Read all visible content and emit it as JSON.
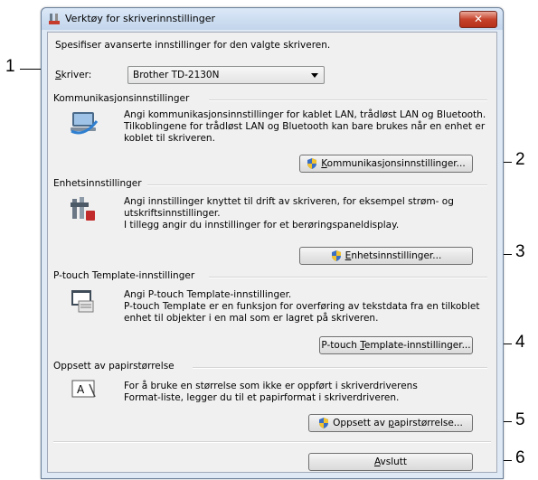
{
  "window": {
    "title": "Verktøy for skriverinnstillinger",
    "close_label": "✕"
  },
  "intro": "Spesifiser avanserte innstillinger for den valgte skriveren.",
  "printer": {
    "label_prefix": "S",
    "label_rest": "kriver:",
    "selected": "Brother TD-2130N"
  },
  "sections": {
    "communication": {
      "title": "Kommunikasjonsinnstillinger",
      "lines": [
        "Angi kommunikasjonsinnstillinger for kablet LAN, trådløst LAN og Bluetooth.",
        "Tilkoblingene for trådløst LAN og Bluetooth kan bare brukes når en enhet er",
        "koblet til skriveren."
      ],
      "button_prefix": "K",
      "button_rest": "ommunikasjonsinnstillinger..."
    },
    "device": {
      "title": "Enhetsinnstillinger",
      "lines": [
        "Angi innstillinger knyttet til drift av skriveren, for eksempel strøm- og",
        "utskriftsinnstillinger.",
        "I tillegg angir du innstillinger for et berøringspaneldisplay."
      ],
      "button_prefix": "E",
      "button_rest": "nhetsinnstillinger..."
    },
    "template": {
      "title": "P-touch Template-innstillinger",
      "lines": [
        "Angi P-touch Template-innstillinger.",
        "P-touch Template er en funksjon for overføring av tekstdata fra en tilkoblet",
        "enhet til objekter i en mal som er lagret på skriveren."
      ],
      "button_pre": "P-touch ",
      "button_prefix": "T",
      "button_rest": "emplate-innstillinger..."
    },
    "paper": {
      "title": "Oppsett av papirstørrelse",
      "lines": [
        "For å bruke en størrelse som ikke er oppført i skriverdriverens",
        "Format-liste, legger du til et papirformat i skriverdriveren."
      ],
      "button_pre": "Oppsett av ",
      "button_prefix": "p",
      "button_rest": "apirstørrelse..."
    }
  },
  "exit": {
    "prefix": "A",
    "rest": "vslutt"
  },
  "callouts": [
    "1",
    "2",
    "3",
    "4",
    "5",
    "6"
  ],
  "icons": [
    "settings-tool-icon",
    "network-icon",
    "device-settings-icon",
    "template-icon",
    "paper-size-icon",
    "shield-icon"
  ]
}
